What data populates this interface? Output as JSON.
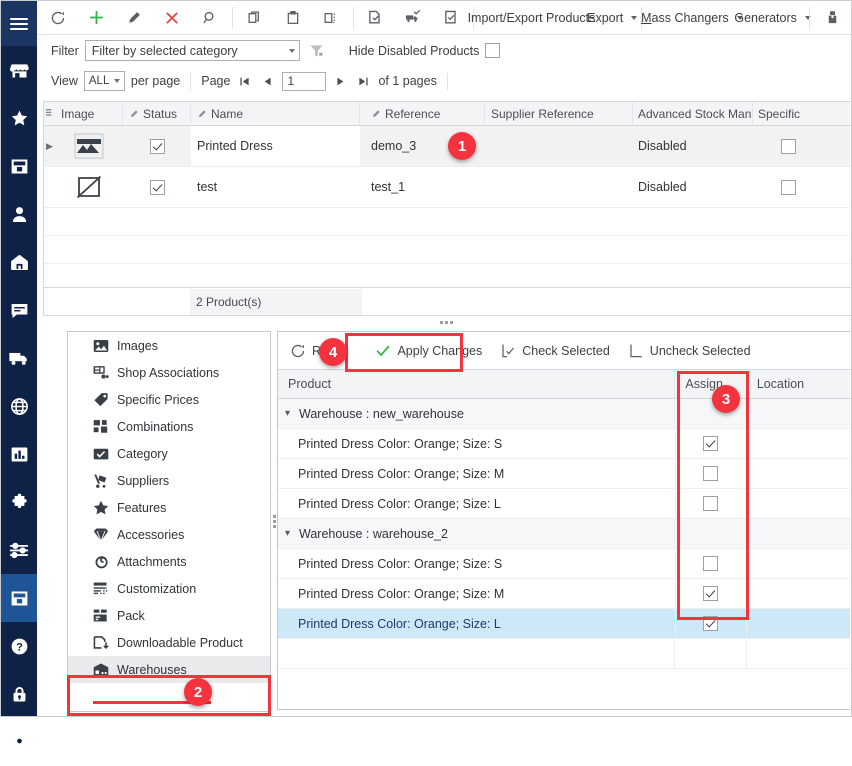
{
  "rail": {
    "items": [
      {
        "name": "menu-toggle",
        "icon": "hamburger-icon"
      },
      {
        "name": "shop",
        "icon": "store-icon"
      },
      {
        "name": "favorites",
        "icon": "star-icon"
      },
      {
        "name": "orders",
        "icon": "inbox-icon"
      },
      {
        "name": "customers",
        "icon": "person-icon"
      },
      {
        "name": "home",
        "icon": "home-icon"
      },
      {
        "name": "messages",
        "icon": "chat-icon"
      },
      {
        "name": "shipping",
        "icon": "truck-icon"
      },
      {
        "name": "international",
        "icon": "globe-icon"
      },
      {
        "name": "stats",
        "icon": "bar-chart-icon"
      },
      {
        "name": "modules",
        "icon": "puzzle-icon"
      },
      {
        "name": "preferences",
        "icon": "sliders-icon"
      },
      {
        "name": "catalog",
        "icon": "inbox-icon"
      },
      {
        "name": "help",
        "icon": "question-icon"
      },
      {
        "name": "security",
        "icon": "lock-icon"
      },
      {
        "name": "settings",
        "icon": "gear-icon"
      }
    ]
  },
  "toolbar": {
    "buttons": [
      {
        "icon": "refresh-icon",
        "label": ""
      },
      {
        "icon": "plus-icon",
        "label": ""
      },
      {
        "icon": "pencil-icon",
        "label": ""
      },
      {
        "icon": "delete-x-icon",
        "label": ""
      },
      {
        "icon": "search-icon",
        "label": ""
      },
      {
        "icon": "copy-icon",
        "label": ""
      },
      {
        "icon": "paste-icon",
        "label": ""
      },
      {
        "icon": "duplicate-dashed-icon",
        "label": ""
      },
      {
        "icon": "check-all-icon",
        "label": ""
      },
      {
        "icon": "uncheck-all-icon",
        "label": ""
      },
      {
        "icon": "check-box-icon",
        "label": ""
      }
    ],
    "import_export_products": "Import/Export Products",
    "export": "Export",
    "mass_changers": "Mass Changers",
    "generators": "Generators"
  },
  "filterbar": {
    "filter_label": "Filter",
    "category_value": "Filter by selected category",
    "clear_filter_icon": "filter-clear-icon",
    "hide_disabled_label": "Hide Disabled Products",
    "hide_disabled_checked": false
  },
  "pagebar": {
    "view_label": "View",
    "per_page_value": "ALL",
    "per_page_label": "per page",
    "page_label": "Page",
    "page_value": "1",
    "of_pages": "of 1 pages"
  },
  "product_grid": {
    "columns": [
      {
        "label": "Image",
        "editable": false
      },
      {
        "label": "Status",
        "editable": true
      },
      {
        "label": "Name",
        "editable": true
      },
      {
        "label": "Reference",
        "editable": true
      },
      {
        "label": "Supplier Reference",
        "editable": false
      },
      {
        "label": "Advanced Stock Man",
        "editable": false
      },
      {
        "label": "Specific",
        "editable": false
      }
    ],
    "rows": [
      {
        "image": "photo-thumbnail",
        "status": true,
        "name": "Printed Dress",
        "reference": "demo_3",
        "supplier_reference": "",
        "advanced_stock": "Disabled",
        "specific": false,
        "selected": true
      },
      {
        "image": "no-photo-thumbnail",
        "status": true,
        "name": "test",
        "reference": "test_1",
        "supplier_reference": "",
        "advanced_stock": "Disabled",
        "specific": false,
        "selected": false
      }
    ],
    "footer_count": "2 Product(s)"
  },
  "nav_list": {
    "items": [
      {
        "label": "Images",
        "icon": "image-icon"
      },
      {
        "label": "Shop Associations",
        "icon": "shop-assoc-icon"
      },
      {
        "label": "Specific Prices",
        "icon": "price-tag-icon"
      },
      {
        "label": "Combinations",
        "icon": "combinations-icon"
      },
      {
        "label": "Category",
        "icon": "category-check-icon"
      },
      {
        "label": "Suppliers",
        "icon": "hand-truck-icon"
      },
      {
        "label": "Features",
        "icon": "star-icon"
      },
      {
        "label": "Accessories",
        "icon": "diamond-icon"
      },
      {
        "label": "Attachments",
        "icon": "paperclip-icon"
      },
      {
        "label": "Customization",
        "icon": "customization-icon"
      },
      {
        "label": "Pack",
        "icon": "pack-icon"
      },
      {
        "label": "Downloadable Product",
        "icon": "download-icon"
      },
      {
        "label": "Warehouses",
        "icon": "warehouse-icon",
        "active": true
      }
    ]
  },
  "detail_toolbar": {
    "refresh": "Ref",
    "apply_changes": "Apply Changes",
    "check_selected": "Check Selected",
    "uncheck_selected": "Uncheck Selected"
  },
  "detail_grid": {
    "columns": [
      "Product",
      "Assign",
      "Location"
    ],
    "rows": [
      {
        "type": "group",
        "product": "Warehouse : new_warehouse",
        "assign": null,
        "location": "",
        "expanded": true
      },
      {
        "type": "item",
        "product": "Printed Dress Color: Orange; Size: S",
        "assign": true,
        "location": ""
      },
      {
        "type": "item",
        "product": "Printed Dress Color: Orange; Size: M",
        "assign": false,
        "location": ""
      },
      {
        "type": "item",
        "product": "Printed Dress Color: Orange; Size: L",
        "assign": false,
        "location": ""
      },
      {
        "type": "group",
        "product": "Warehouse : warehouse_2",
        "assign": null,
        "location": "",
        "expanded": true
      },
      {
        "type": "item",
        "product": "Printed Dress Color: Orange; Size: S",
        "assign": false,
        "location": ""
      },
      {
        "type": "item",
        "product": "Printed Dress Color: Orange; Size: M",
        "assign": true,
        "location": ""
      },
      {
        "type": "item",
        "product": "Printed Dress Color: Orange; Size: L",
        "assign": true,
        "location": "",
        "highlighted": true
      }
    ]
  },
  "annotations": {
    "markers": [
      {
        "number": "1",
        "target": "product-reference-cell"
      },
      {
        "number": "2",
        "target": "nav-item-warehouses"
      },
      {
        "number": "3",
        "target": "assign-column"
      },
      {
        "number": "4",
        "target": "apply-changes-button"
      }
    ],
    "accent_color": "#f5333f"
  }
}
